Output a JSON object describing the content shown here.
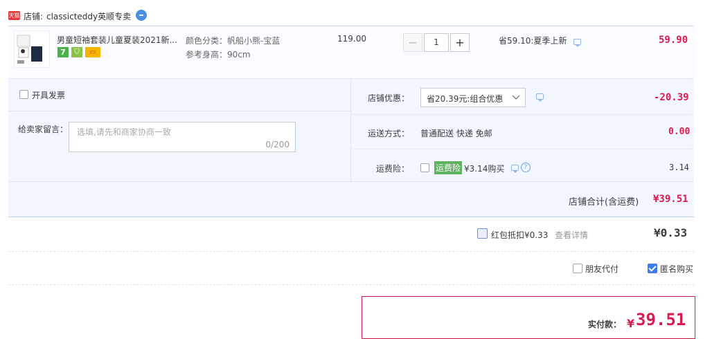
{
  "shop": {
    "badge": "天猫",
    "label": "店铺:",
    "name": "classicteddy英顺专卖"
  },
  "item": {
    "title": "男童短袖套装儿童夏装2021新...",
    "spec_color": "颜色分类：帆船小熊-宝蓝",
    "spec_height": "参考身高：90cm",
    "unit_price": "119.00",
    "qty_minus": "−",
    "qty_value": "1",
    "qty_plus": "+",
    "promo": "省59.10:夏季上新",
    "subtotal": "59.90",
    "badges": [
      "7",
      "⛉",
      "▭"
    ]
  },
  "invoice": {
    "label": "开具发票"
  },
  "message": {
    "label": "给卖家留言：",
    "placeholder": "选填,请先和商家协商一致",
    "counter": "0/200"
  },
  "discount": {
    "label": "店铺优惠：",
    "selected": "省20.39元:组合优惠",
    "value": "-20.39"
  },
  "shipping": {
    "label": "运送方式：",
    "method": "普通配送 快递 免邮",
    "value": "0.00"
  },
  "insurance": {
    "label": "运费险：",
    "tag": "运费险",
    "price": "¥3.14购买",
    "value": "3.14"
  },
  "total": {
    "label": "店铺合计(含运费)",
    "value": "¥39.51"
  },
  "redpacket": {
    "label": "红包抵扣¥0.33",
    "link": "查看详情",
    "value": "¥0.33"
  },
  "options": {
    "friend_pay": "朋友代付",
    "anonymous": "匿名购买"
  },
  "pay": {
    "label": "实付款：",
    "currency": "¥",
    "amount": "39.51"
  },
  "colors": {
    "accent_red": "#d91a4f",
    "panel_blue": "#f2f7ff",
    "check_blue": "#3d7cf3",
    "tag_green": "#5fb25f"
  }
}
